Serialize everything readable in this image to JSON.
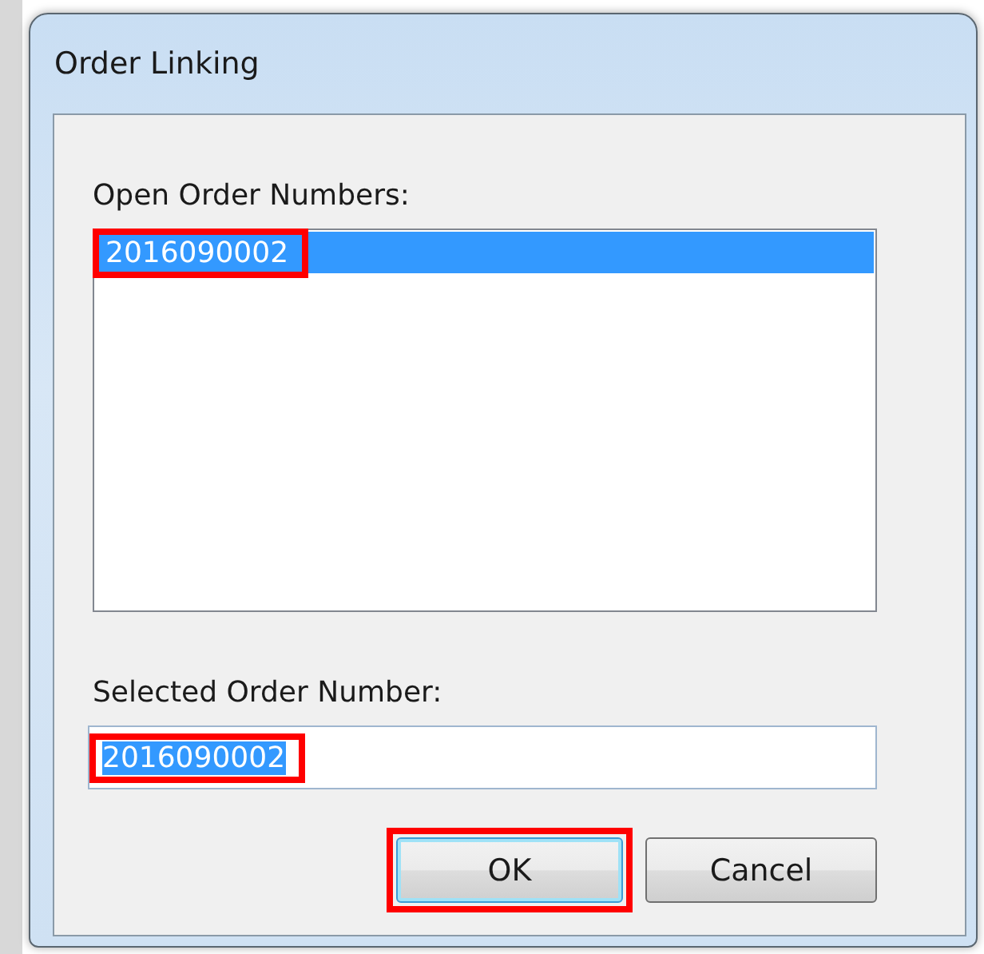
{
  "window": {
    "title": "Order Linking"
  },
  "open_orders": {
    "label": "Open Order Numbers:",
    "items": [
      {
        "text": "2016090002",
        "selected": true,
        "highlighted": true
      }
    ]
  },
  "selected_order": {
    "label": "Selected Order Number:",
    "value": "2016090002",
    "value_selected": true,
    "highlighted": true
  },
  "buttons": [
    {
      "label": "OK",
      "default": true,
      "highlighted": true
    },
    {
      "label": "Cancel",
      "default": false,
      "highlighted": false
    }
  ]
}
